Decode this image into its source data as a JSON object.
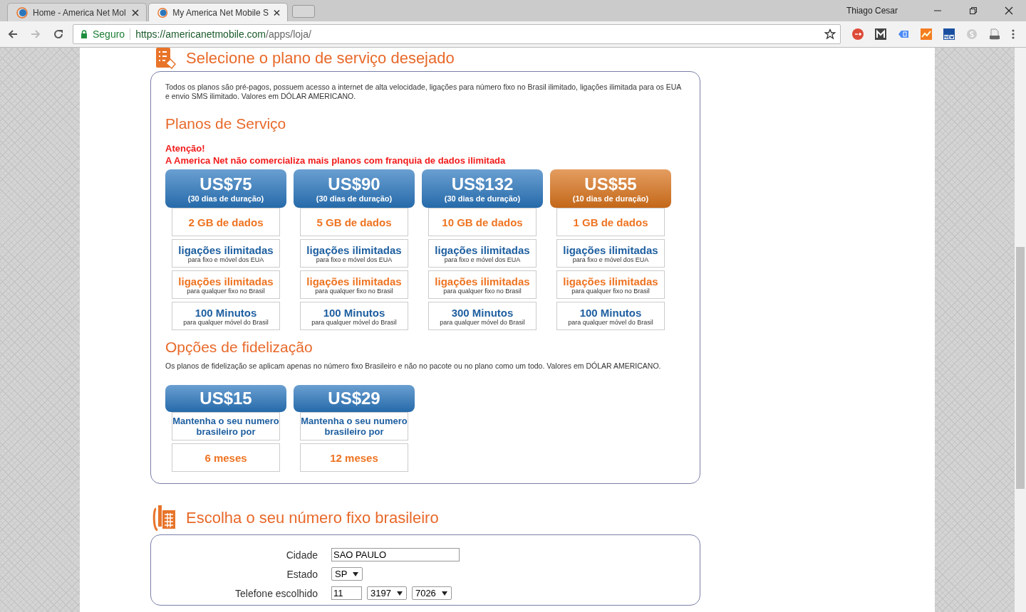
{
  "browser": {
    "tabs": [
      {
        "title": "Home - America Net Mol",
        "selected": false
      },
      {
        "title": "My America Net Mobile S",
        "selected": true
      }
    ],
    "profile": "Thiago Cesar",
    "secure_label": "Seguro",
    "url_host": "https://americanetmobile.com",
    "url_path": "/apps/loja/"
  },
  "plans_section": {
    "title": "Selecione o plano de serviço desejado",
    "intro": "Todos os planos são pré-pagos, possuem acesso a internet de alta velocidade, ligações para número fixo no Brasil ilimitado, ligações ilimitada para os EUA e envio SMS ilimitado. Valores em DÓLAR AMERICANO.",
    "plans_heading": "Planos de Serviço",
    "warning": [
      "Atenção!",
      "A America Net não comercializa mais planos com franquia de dados ilimitada"
    ],
    "plans": [
      {
        "price": "US$75",
        "duration": "(30 dias de duração)",
        "color": "#2a76bd",
        "features": [
          {
            "kind": "data",
            "title": "2 GB de dados"
          },
          {
            "kind": "standard",
            "title": "ligações ilimitadas",
            "note": "para fixo e móvel dos EUA"
          },
          {
            "kind": "highlight",
            "title": "ligações ilimitadas",
            "note": "para qualquer fixo no Brasil"
          },
          {
            "kind": "standard",
            "title": "100 Minutos",
            "note": "para qualquer móvel do Brasil"
          }
        ]
      },
      {
        "price": "US$90",
        "duration": "(30 dias de duração)",
        "color": "#2a76bd",
        "features": [
          {
            "kind": "data",
            "title": "5 GB de dados"
          },
          {
            "kind": "standard",
            "title": "ligações ilimitadas",
            "note": "para fixo e móvel dos EUA"
          },
          {
            "kind": "highlight",
            "title": "ligações ilimitadas",
            "note": "para qualquer fixo no Brasil"
          },
          {
            "kind": "standard",
            "title": "100 Minutos",
            "note": "para qualquer móvel do Brasil"
          }
        ]
      },
      {
        "price": "US$132",
        "duration": "(30 dias de duração)",
        "color": "#2a76bd",
        "features": [
          {
            "kind": "data",
            "title": "10 GB de dados"
          },
          {
            "kind": "standard",
            "title": "ligações ilimitadas",
            "note": "para fixo e móvel dos EUA"
          },
          {
            "kind": "highlight",
            "title": "ligações ilimitadas",
            "note": "para qualquer fixo no Brasil"
          },
          {
            "kind": "standard",
            "title": "300 Minutos",
            "note": "para qualquer móvel do Brasil"
          }
        ]
      },
      {
        "price": "US$55",
        "duration": "(10 dias de duração)",
        "color": "#d9731c",
        "features": [
          {
            "kind": "data",
            "title": "1 GB de dados"
          },
          {
            "kind": "standard",
            "title": "ligações ilimitadas",
            "note": "para fixo e móvel dos EUA"
          },
          {
            "kind": "highlight",
            "title": "ligações ilimitadas",
            "note": "para qualquer fixo no Brasil"
          },
          {
            "kind": "standard",
            "title": "100 Minutos",
            "note": "para qualquer móvel do Brasil"
          }
        ]
      }
    ],
    "loyalty_heading": "Opções de fidelização",
    "loyalty_intro": "Os planos de fidelização se aplicam apenas no número fixo Brasileiro e não no pacote ou no plano como um todo. Valores em DÓLAR AMERICANO.",
    "loyalty": [
      {
        "price": "US$15",
        "description": "Mantenha o seu numero brasileiro por",
        "period": "6 meses"
      },
      {
        "price": "US$29",
        "description": "Mantenha o seu numero brasileiro por",
        "period": "12 meses"
      }
    ]
  },
  "number_section": {
    "title": "Escolha o seu número fixo brasileiro",
    "city": {
      "label": "Cidade",
      "value": "SAO PAULO"
    },
    "state": {
      "label": "Estado",
      "value": "SP"
    },
    "phone": {
      "label": "Telefone escolhido",
      "area": "11",
      "prefix": "3197",
      "suffix": "7026"
    }
  }
}
